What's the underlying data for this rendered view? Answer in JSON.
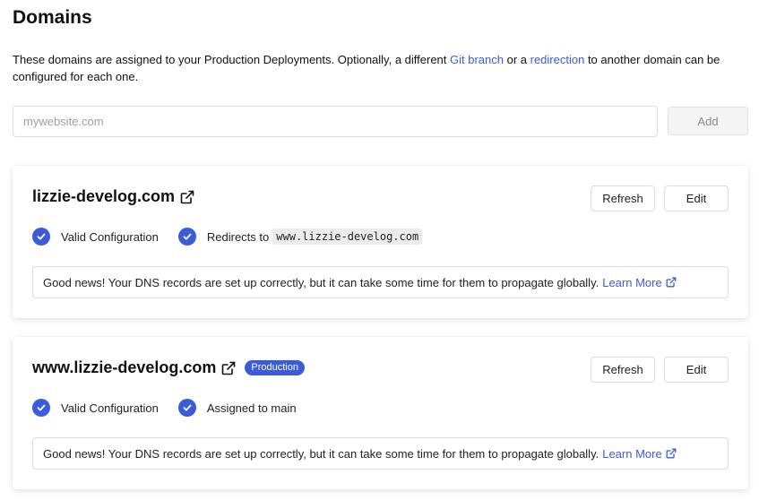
{
  "page": {
    "title": "Domains",
    "intro_before_git": "These domains are assigned to your Production Deployments. Optionally, a different ",
    "git_branch_link": "Git branch",
    "intro_between": " or a ",
    "redirection_link": "redirection",
    "intro_after": " to another domain can be configured for each one."
  },
  "add_domain": {
    "placeholder": "mywebsite.com",
    "button_label": "Add"
  },
  "colors": {
    "accent": "#3b5bdb"
  },
  "cards": [
    {
      "domain": "lizzie-develog.com",
      "badge": "",
      "refresh_label": "Refresh",
      "edit_label": "Edit",
      "status1": "Valid Configuration",
      "status2_prefix": "Redirects to",
      "status2_code": "www.lizzie-develog.com",
      "info_text": "Good news! Your DNS records are set up correctly, but it can take some time for them to propagate globally.",
      "learn_more": "Learn More"
    },
    {
      "domain": "www.lizzie-develog.com",
      "badge": "Production",
      "refresh_label": "Refresh",
      "edit_label": "Edit",
      "status1": "Valid Configuration",
      "status2_prefix": "Assigned to main",
      "status2_code": "",
      "info_text": "Good news! Your DNS records are set up correctly, but it can take some time for them to propagate globally.",
      "learn_more": "Learn More"
    }
  ]
}
